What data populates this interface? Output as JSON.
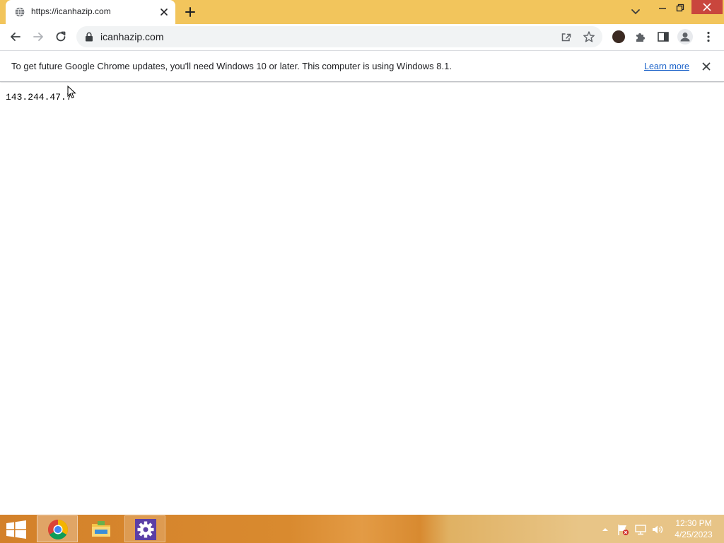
{
  "browser": {
    "tab": {
      "title": "https://icanhazip.com",
      "favicon": "globe-icon"
    },
    "address_bar": {
      "url": "icanhazip.com",
      "secure_icon": "lock-icon"
    },
    "toolbar_icons": [
      "back-arrow-icon",
      "forward-arrow-icon",
      "reload-icon",
      "share-icon",
      "star-icon",
      "puzzle-icon",
      "side-panel-icon",
      "profile-icon",
      "kebab-menu-icon"
    ]
  },
  "infobar": {
    "message": "To get future Google Chrome updates, you'll need Windows 10 or later. This computer is using Windows 8.1.",
    "link": "Learn more"
  },
  "page": {
    "ip_address": "143.244.47.7"
  },
  "taskbar": {
    "apps": [
      "chrome-icon",
      "file-explorer-icon",
      "settings-gear-icon"
    ],
    "clock": {
      "time": "12:30 PM",
      "date": "4/25/2023"
    }
  },
  "colors": {
    "titlebar": "#f2c55c",
    "link": "#1a62c9",
    "close_hover": "#c9463d"
  }
}
